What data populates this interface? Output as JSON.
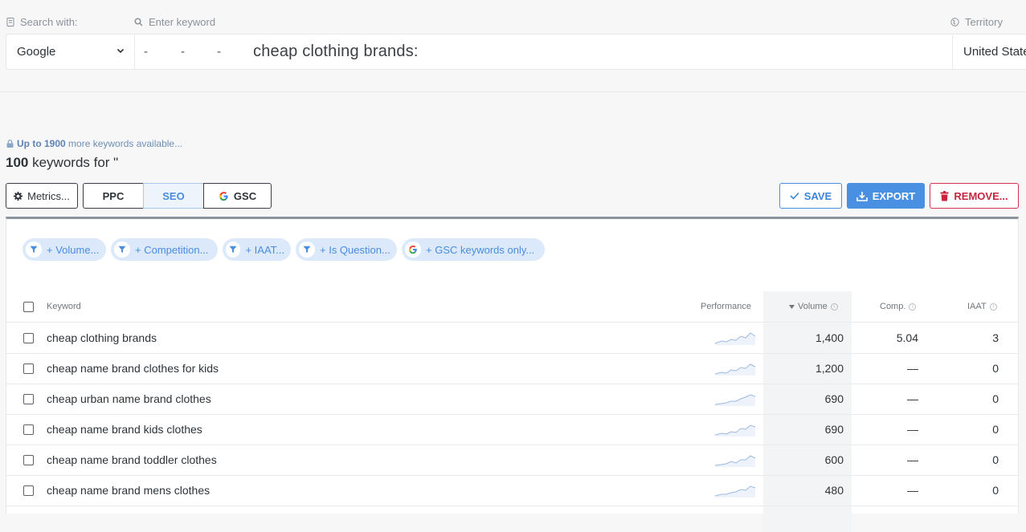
{
  "search": {
    "search_with_label": "Search with:",
    "keyword_label": "Enter keyword",
    "territory_label": "Territory",
    "engine": "Google",
    "dashes": [
      "-",
      "-",
      "-"
    ],
    "keyword_value": "cheap clothing brands:",
    "territory_value": "United States"
  },
  "results": {
    "more_bold": "Up to 1900",
    "more_text": " more keywords available...",
    "count_bold": "100",
    "count_text": " keywords for \""
  },
  "toolbar": {
    "metrics": "Metrics...",
    "ppc": "PPC",
    "seo": "SEO",
    "gsc": "GSC",
    "save": "SAVE",
    "export": "EXPORT",
    "remove": "REMOVE..."
  },
  "filters": [
    "+ Volume...",
    "+ Competition...",
    "+ IAAT...",
    "+ Is Question...",
    "+ GSC keywords only..."
  ],
  "table": {
    "headers": {
      "keyword": "Keyword",
      "performance": "Performance",
      "volume": "Volume",
      "comp": "Comp.",
      "iaat": "IAAT"
    },
    "rows": [
      {
        "keyword": "cheap clothing brands",
        "volume": "1,400",
        "comp": "5.04",
        "iaat": "3"
      },
      {
        "keyword": "cheap name brand clothes for kids",
        "volume": "1,200",
        "comp": "—",
        "iaat": "0"
      },
      {
        "keyword": "cheap urban name brand clothes",
        "volume": "690",
        "comp": "—",
        "iaat": "0"
      },
      {
        "keyword": "cheap name brand kids clothes",
        "volume": "690",
        "comp": "—",
        "iaat": "0"
      },
      {
        "keyword": "cheap name brand toddler clothes",
        "volume": "600",
        "comp": "—",
        "iaat": "0"
      },
      {
        "keyword": "cheap name brand mens clothes",
        "volume": "480",
        "comp": "—",
        "iaat": "0"
      }
    ]
  },
  "colors": {
    "accent": "#4a90e2",
    "danger": "#d4344e",
    "chip_bg": "#dbe9fb"
  }
}
